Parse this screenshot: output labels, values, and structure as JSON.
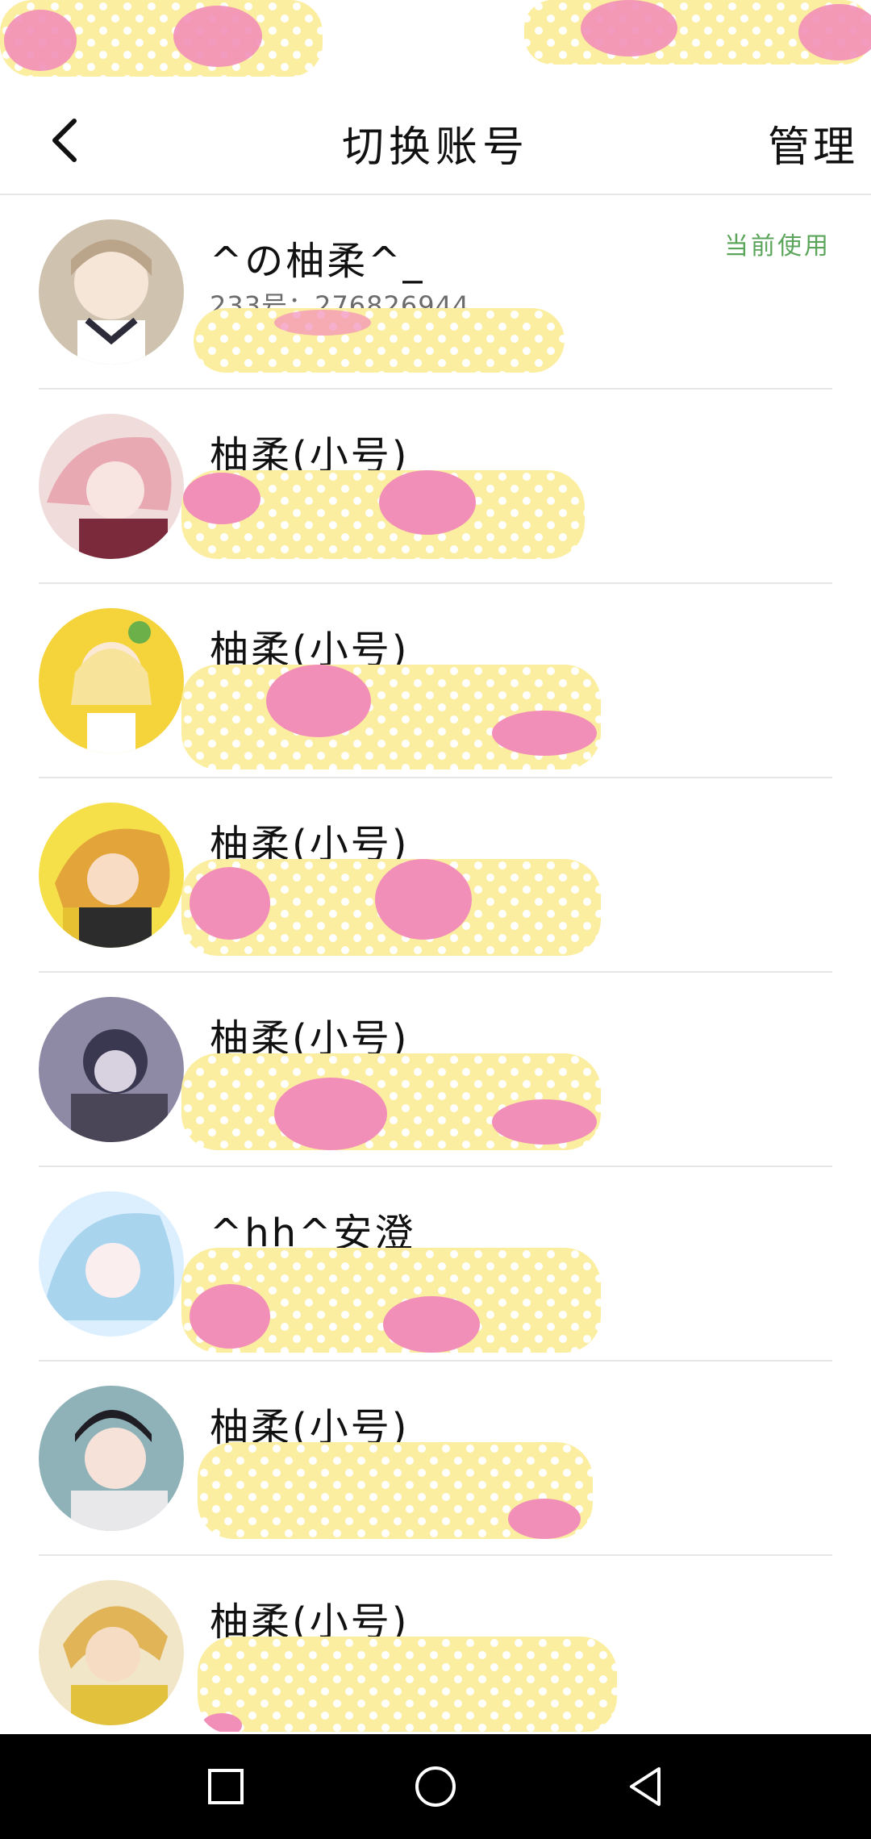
{
  "header": {
    "title": "切换账号",
    "manage_label": "管理",
    "back_icon": "chevron-left-icon"
  },
  "accounts": [
    {
      "nickname": "^の柚柔^_",
      "id_label": "233号：276826944",
      "current_label": "当前使用",
      "is_current": true,
      "avatar_color": "#cfc3b0"
    },
    {
      "nickname": "柚柔(小号)",
      "avatar_color": "#e8a9b3"
    },
    {
      "nickname": "柚柔(小号)",
      "avatar_color": "#f5d33a"
    },
    {
      "nickname": "柚柔(小号)",
      "avatar_color": "#e3a43a"
    },
    {
      "nickname": "柚柔(小号)",
      "avatar_color": "#8e8aa6"
    },
    {
      "nickname": "^hh^安澄",
      "avatar_color": "#a9d4ee"
    },
    {
      "nickname": "柚柔(小号)",
      "avatar_color": "#8fb2b8"
    },
    {
      "nickname": "柚柔(小号)",
      "avatar_color": "#e0b457"
    }
  ],
  "navbar": {
    "items": [
      "square-recents-icon",
      "circle-home-icon",
      "triangle-back-icon"
    ]
  },
  "colors": {
    "current_badge": "#5aa55a",
    "divider": "#e6e6e6",
    "sticker_yellow": "#fbeea0",
    "sticker_pink": "#f28fb8",
    "navbar": "#000000"
  }
}
